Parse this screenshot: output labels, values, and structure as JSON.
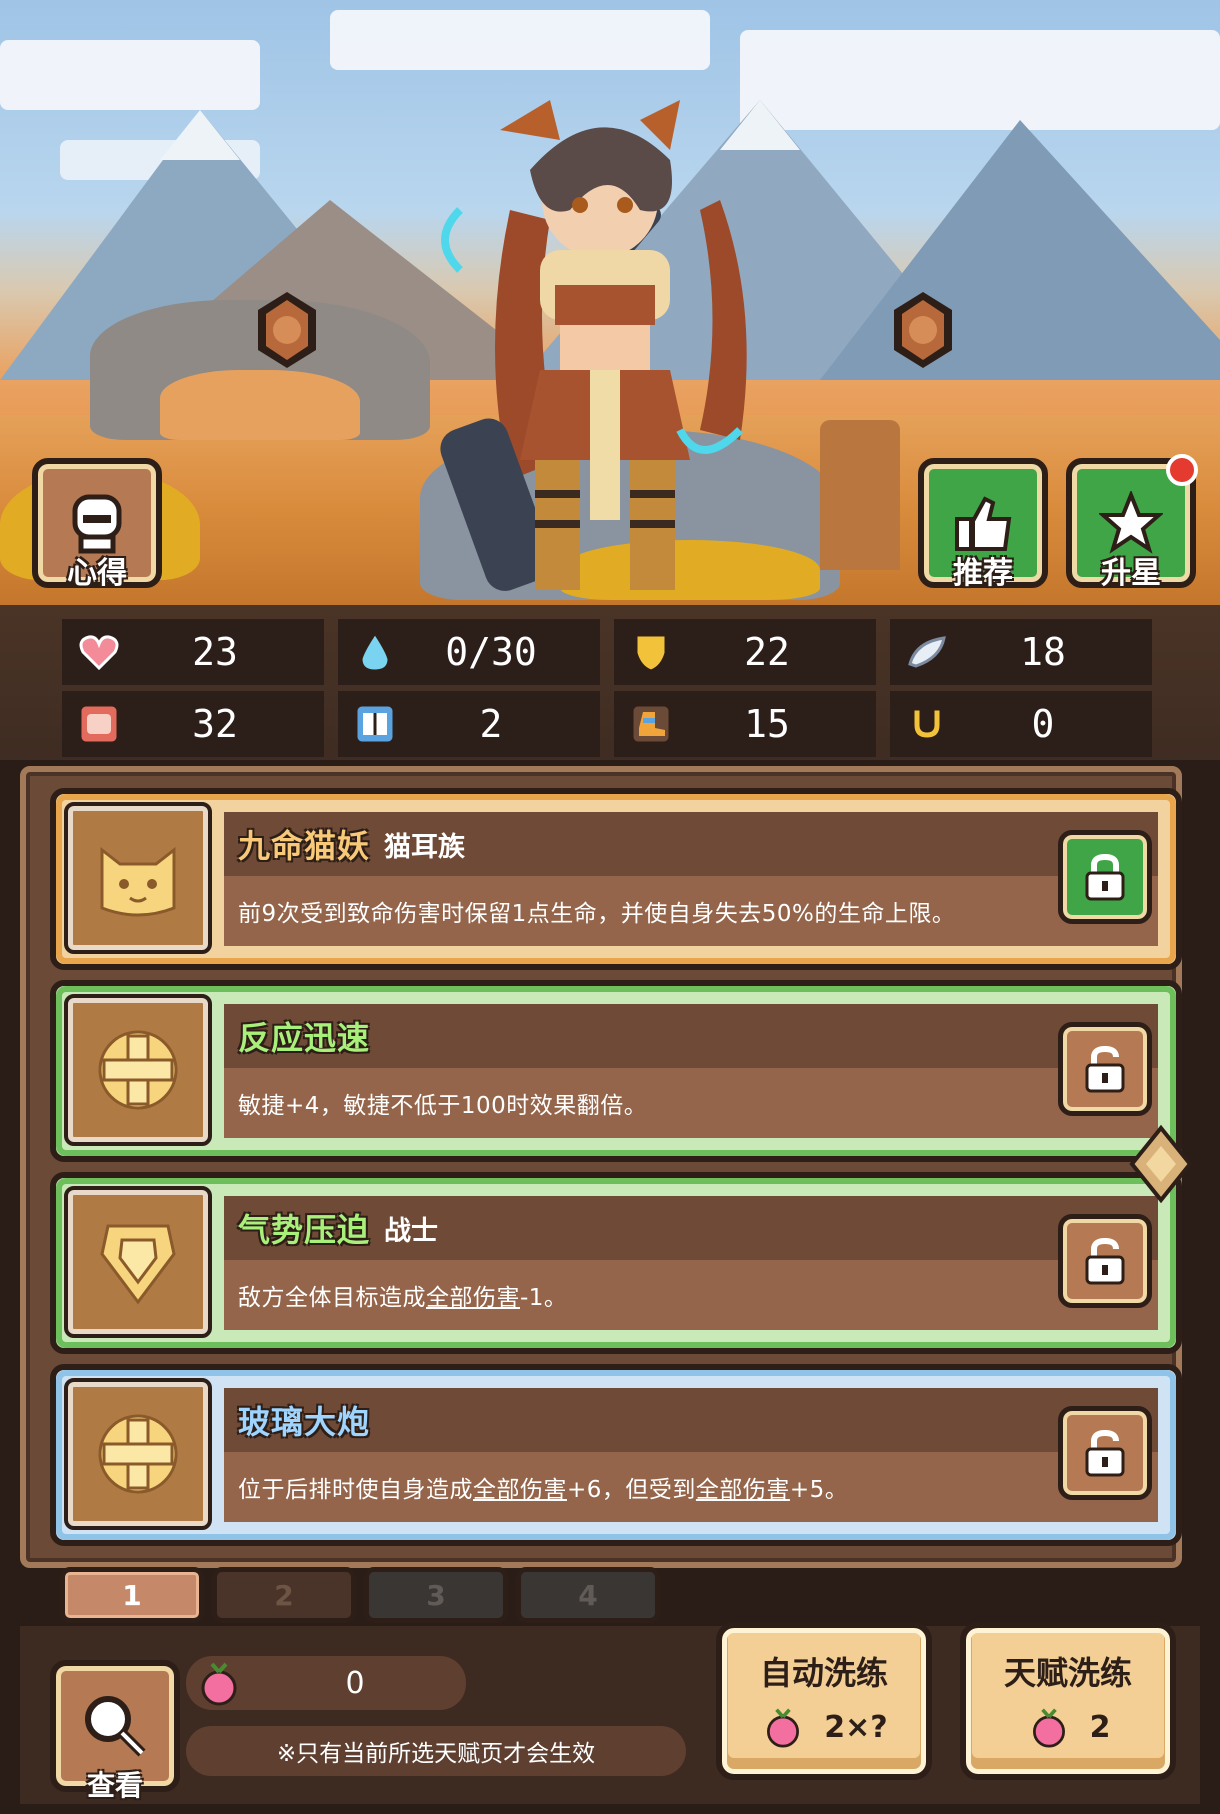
{
  "top_buttons": {
    "insight_label": "心得",
    "recommend_label": "推荐",
    "star_up_label": "升星"
  },
  "stats": [
    {
      "icon": "heart-icon",
      "value": "23",
      "color": "#ef6b7a"
    },
    {
      "icon": "mana-drop-icon",
      "value": "0/30",
      "color": "#7ad3f0"
    },
    {
      "icon": "shield-icon",
      "value": "22",
      "color": "#f2c33a"
    },
    {
      "icon": "feather-icon",
      "value": "18",
      "color": "#e8eef6"
    },
    {
      "icon": "fist-icon",
      "value": "32",
      "color": "#e36b5d"
    },
    {
      "icon": "book-icon",
      "value": "2",
      "color": "#5aa3e0"
    },
    {
      "icon": "boot-icon",
      "value": "15",
      "color": "#f0a43a"
    },
    {
      "icon": "horseshoe-icon",
      "value": "0",
      "color": "#f2c33a"
    }
  ],
  "talents": [
    {
      "name": "九命猫妖",
      "tag": "猫耳族",
      "desc": "前9次受到致命伤害时保留1点生命，并使自身失去50%的生命上限。",
      "frame_color": "#e9a54c",
      "name_color": "#f7c978",
      "icon": "cat-face-icon",
      "locked": true
    },
    {
      "name": "反应迅速",
      "tag": "",
      "desc": "敏捷+4，敏捷不低于100时效果翻倍。",
      "frame_color": "#6dbf5b",
      "name_color": "#a9f07a",
      "icon": "cross-emblem-icon",
      "locked": false
    },
    {
      "name": "气势压迫",
      "tag": "战士",
      "desc_parts": [
        "敌方全体目标造成",
        "全部伤害",
        "-1。"
      ],
      "frame_color": "#6dbf5b",
      "name_color": "#a9f07a",
      "icon": "shield-emblem-icon",
      "locked": false
    },
    {
      "name": "玻璃大炮",
      "tag": "",
      "desc_parts": [
        "位于后排时使自身造成",
        "全部伤害",
        "+6，但受到",
        "全部伤害",
        "+5。"
      ],
      "frame_color": "#8fc3e8",
      "name_color": "#9fd4ff",
      "icon": "cross-emblem-icon",
      "locked": false
    }
  ],
  "pages": [
    "1",
    "2",
    "3",
    "4"
  ],
  "bottom": {
    "view_label": "查看",
    "fruit_count": "0",
    "note": "※只有当前所选天赋页才会生效",
    "auto_reroll_label": "自动洗练",
    "auto_reroll_cost": "2×?",
    "talent_reroll_label": "天赋洗练",
    "talent_reroll_cost": "2"
  }
}
